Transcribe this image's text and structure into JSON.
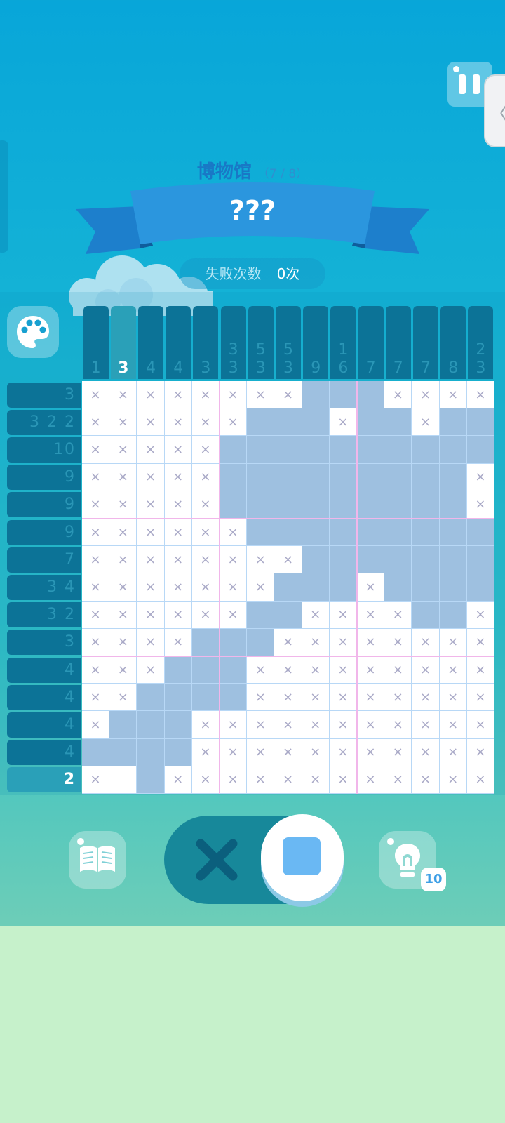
{
  "header": {
    "level_name": "博物馆",
    "progress": "（7 / 8）",
    "puzzle_title": "???",
    "fail_label": "失败次数",
    "fail_count": "0次"
  },
  "icons": {
    "pause": "pause-icon",
    "side_tab": "chevron-left-icon",
    "palette": "palette-icon",
    "book": "book-icon",
    "hint": "lightbulb-icon",
    "cross_mode": "x-mark-icon",
    "fill_mode": "square-icon"
  },
  "colors": {
    "clue_bg": "#0c7397",
    "clue_highlight": "#2aa0b8",
    "filled_cell": "#9ec0e0",
    "mode_fill": "#6ab8f3",
    "cross_color": "#0e6f8e"
  },
  "controls": {
    "hint_count": "10",
    "selected_mode": "fill"
  },
  "puzzle": {
    "size": 15,
    "column_clues": [
      [
        "1"
      ],
      [
        "3"
      ],
      [
        "4"
      ],
      [
        "4"
      ],
      [
        "3"
      ],
      [
        "3",
        "3"
      ],
      [
        "5",
        "3"
      ],
      [
        "5",
        "3"
      ],
      [
        "9"
      ],
      [
        "1",
        "6"
      ],
      [
        "7"
      ],
      [
        "7"
      ],
      [
        "7"
      ],
      [
        "8"
      ],
      [
        "2",
        "3"
      ]
    ],
    "row_clues": [
      "3",
      "3 2 2",
      "10",
      "9",
      "9",
      "9",
      "7",
      "3 4",
      "3 2",
      "3",
      "4",
      "4",
      "4",
      "4",
      "2"
    ],
    "highlighted_column": 1,
    "highlighted_row": 14,
    "grid": [
      "xxxxxxxxfffxxxx",
      "xxxxxxfffxffxff",
      "xxxxxffffffffff",
      "xxxxxfffffffffx",
      "xxxxxfffffffffx",
      "xxxxxxfffffffff",
      "xxxxxxxxfffffff",
      "xxxxxxxfffxffff",
      "xxxxxxffxxxxffx",
      "xxxxfffxxxxxxxx",
      "xxxfffxxxxxxxxx",
      "xxffffxxxxxxxxx",
      "xfffxxxxxxxxxxx",
      "ffffxxxxxxxxxxx",
      "x.fxxxxxxxxxxxx"
    ]
  }
}
